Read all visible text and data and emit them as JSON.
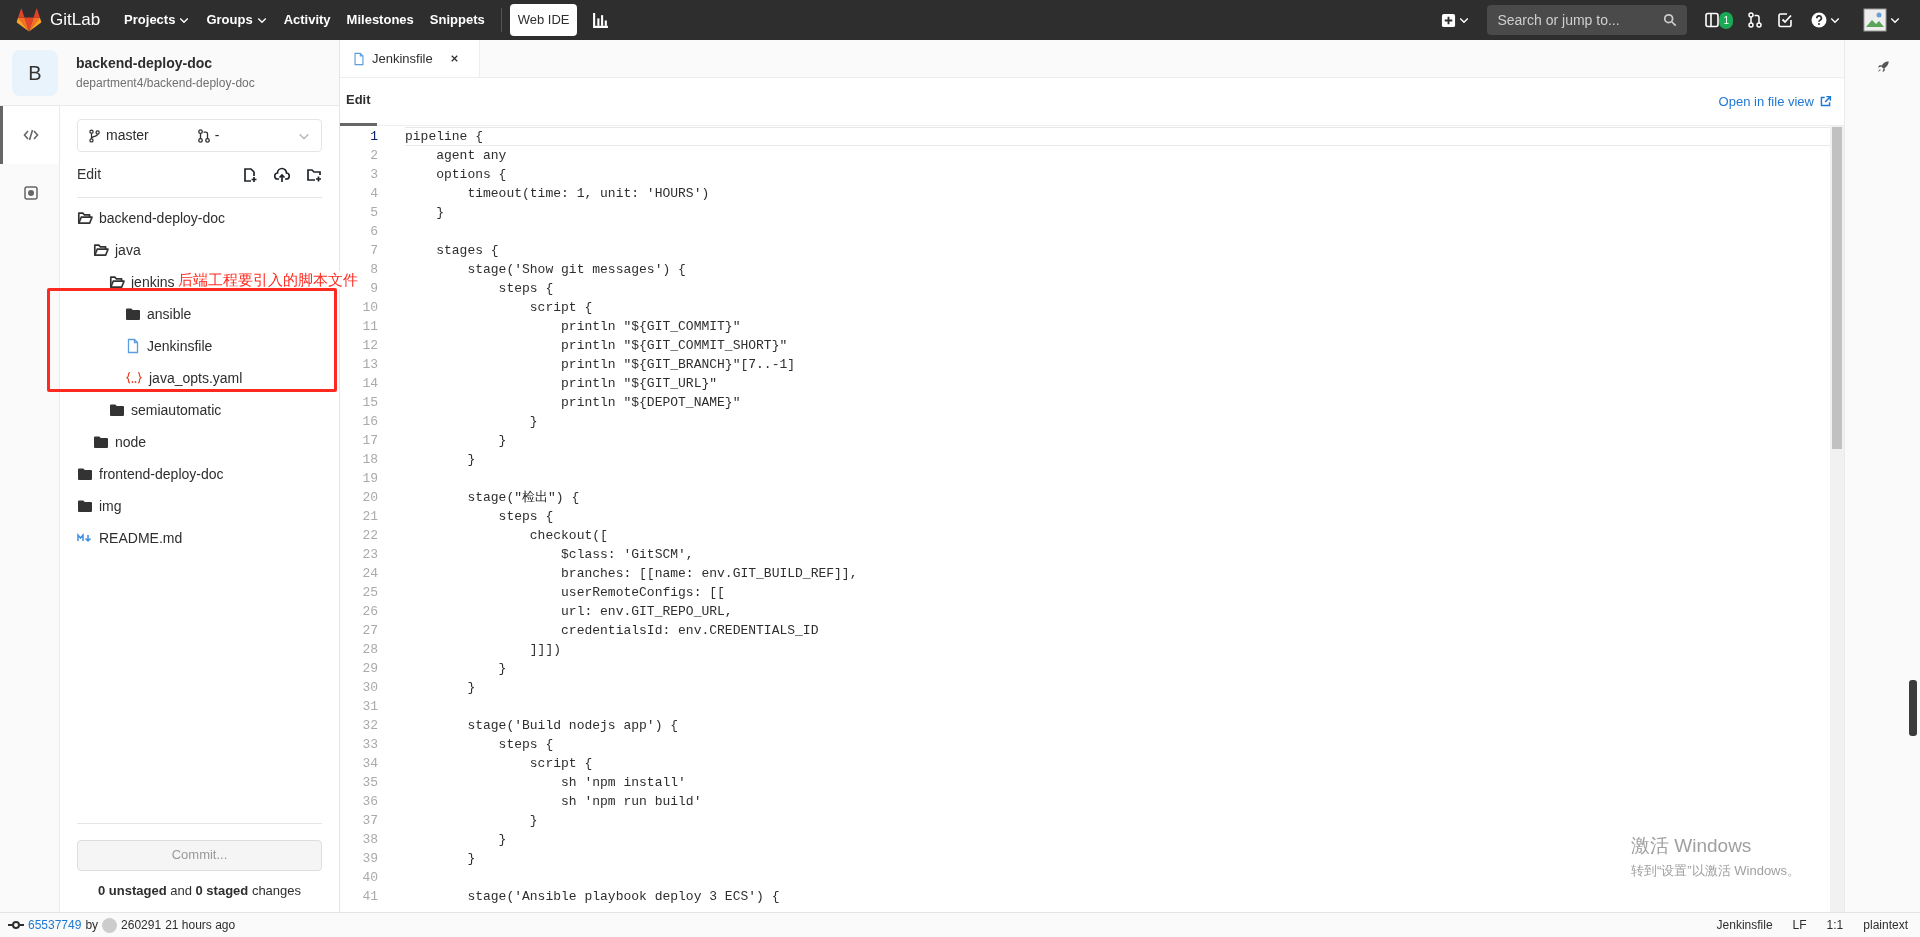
{
  "navbar": {
    "brand": "GitLab",
    "links": [
      {
        "label": "Projects",
        "dropdown": true
      },
      {
        "label": "Groups",
        "dropdown": true
      },
      {
        "label": "Activity",
        "dropdown": false
      },
      {
        "label": "Milestones",
        "dropdown": false
      },
      {
        "label": "Snippets",
        "dropdown": false
      }
    ],
    "web_ide": {
      "label": "Web IDE",
      "selected": true
    },
    "search": {
      "placeholder": "Search or jump to..."
    },
    "issues_count": "1"
  },
  "project": {
    "avatar": "B",
    "name": "backend-deploy-doc",
    "path": "department4/backend-deploy-doc"
  },
  "activity_bar": [
    {
      "kind": "code",
      "selected": true
    },
    {
      "kind": "commit",
      "selected": false
    }
  ],
  "branch": {
    "name": "master",
    "merge_request": "-"
  },
  "tree_header": "Edit",
  "tree": [
    {
      "name": "backend-deploy-doc",
      "kind": "folder",
      "expanded": true,
      "children": [
        {
          "name": "java",
          "kind": "folder",
          "expanded": true,
          "children": [
            {
              "name": "jenkins",
              "kind": "folder",
              "expanded": true,
              "children": [
                {
                  "name": "ansible",
                  "kind": "folder",
                  "expanded": false
                },
                {
                  "name": "Jenkinsfile",
                  "kind": "file"
                },
                {
                  "name": "java_opts.yaml",
                  "kind": "yaml"
                }
              ]
            },
            {
              "name": "semiautomatic",
              "kind": "folder",
              "expanded": false
            }
          ]
        },
        {
          "name": "node",
          "kind": "folder",
          "expanded": false
        }
      ]
    },
    {
      "name": "frontend-deploy-doc",
      "kind": "folder",
      "expanded": false
    },
    {
      "name": "img",
      "kind": "folder",
      "expanded": false
    },
    {
      "name": "README.md",
      "kind": "markdown"
    }
  ],
  "commit": {
    "button": "Commit...",
    "summary": "**0 unstaged** and **0 staged** changes"
  },
  "editor": {
    "tabs": [
      {
        "label": "Jenkinsfile",
        "selected": true
      }
    ],
    "mode": "Edit",
    "open_link": "Open in file view",
    "lines": [
      {
        "number": "1",
        "text": "pipeline {",
        "current": true
      },
      {
        "number": "2",
        "text": "    agent any",
        "current": false
      },
      {
        "number": "3",
        "text": "    options {",
        "current": false
      },
      {
        "number": "4",
        "text": "        timeout(time: 1, unit: 'HOURS')",
        "current": false
      },
      {
        "number": "5",
        "text": "    }",
        "current": false
      },
      {
        "number": "6",
        "current": false
      },
      {
        "number": "7",
        "text": "    stages {",
        "current": false
      },
      {
        "number": "8",
        "text": "        stage('Show git messages') {",
        "current": false
      },
      {
        "number": "9",
        "text": "            steps {",
        "current": false
      },
      {
        "number": "10",
        "text": "                script {",
        "current": false
      },
      {
        "number": "11",
        "text": "                    println \"${GIT_COMMIT}\"",
        "current": false
      },
      {
        "number": "12",
        "text": "                    println \"${GIT_COMMIT_SHORT}\"",
        "current": false
      },
      {
        "number": "13",
        "text": "                    println \"${GIT_BRANCH}\"[7..-1]",
        "current": false
      },
      {
        "number": "14",
        "text": "                    println \"${GIT_URL}\"",
        "current": false
      },
      {
        "number": "15",
        "text": "                    println \"${DEPOT_NAME}\"",
        "current": false
      },
      {
        "number": "16",
        "text": "                }",
        "current": false
      },
      {
        "number": "17",
        "text": "            }",
        "current": false
      },
      {
        "number": "18",
        "text": "        }",
        "current": false
      },
      {
        "number": "19",
        "current": false
      },
      {
        "number": "20",
        "text": "        stage(\"检出\") {",
        "current": false
      },
      {
        "number": "21",
        "text": "            steps {",
        "current": false
      },
      {
        "number": "22",
        "text": "                checkout([",
        "current": false
      },
      {
        "number": "23",
        "text": "                    $class: 'GitSCM',",
        "current": false
      },
      {
        "number": "24",
        "text": "                    branches: [[name: env.GIT_BUILD_REF]],",
        "current": false
      },
      {
        "number": "25",
        "text": "                    userRemoteConfigs: [[",
        "current": false
      },
      {
        "number": "26",
        "text": "                    url: env.GIT_REPO_URL,",
        "current": false
      },
      {
        "number": "27",
        "text": "                    credentialsId: env.CREDENTIALS_ID",
        "current": false
      },
      {
        "number": "28",
        "text": "                ]]])",
        "current": false
      },
      {
        "number": "29",
        "text": "            }",
        "current": false
      },
      {
        "number": "30",
        "text": "        }",
        "current": false
      },
      {
        "number": "31",
        "current": false
      },
      {
        "number": "32",
        "text": "        stage('Build nodejs app') {",
        "current": false
      },
      {
        "number": "33",
        "text": "            steps {",
        "current": false
      },
      {
        "number": "34",
        "text": "                script {",
        "current": false
      },
      {
        "number": "35",
        "text": "                    sh 'npm install'",
        "current": false
      },
      {
        "number": "36",
        "text": "                    sh 'npm run build'",
        "current": false
      },
      {
        "number": "37",
        "text": "                }",
        "current": false
      },
      {
        "number": "38",
        "text": "            }",
        "current": false
      },
      {
        "number": "39",
        "text": "        }",
        "current": false
      },
      {
        "number": "40",
        "current": false
      },
      {
        "number": "41",
        "text": "        stage('Ansible playbook deploy 3 ECS') {",
        "current": false
      }
    ]
  },
  "annotation": {
    "text": "后端工程要引入的脚本文件",
    "color": "#ff2a1f"
  },
  "os_notice": {
    "title": "激活 Windows",
    "text": "转到“设置”以激活 Windows。"
  },
  "status_bar": {
    "commit": "65537749",
    "by": "by",
    "author": "260291",
    "time": "21 hours ago",
    "file": "Jenkinsfile",
    "eol": "LF",
    "position": "1:1",
    "language": "plaintext"
  }
}
